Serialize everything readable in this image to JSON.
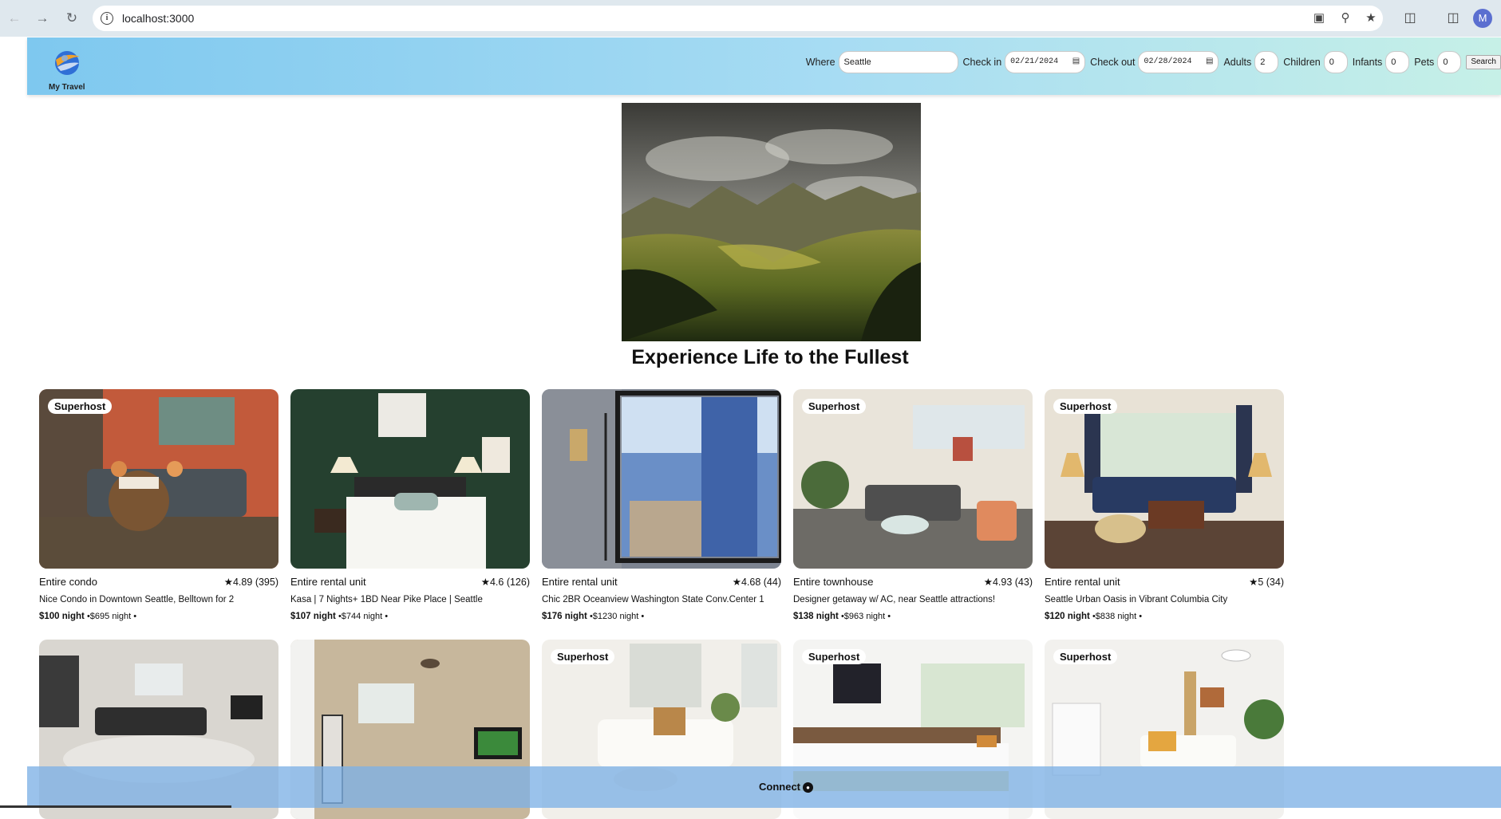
{
  "browser": {
    "url": "localhost:3000",
    "profile_initial": "M",
    "icons": [
      "back-icon",
      "forward-icon",
      "reload-icon",
      "site-info-icon",
      "install-app-icon",
      "zoom-icon",
      "bookmark-star-icon",
      "extensions-icon",
      "side-panel-icon"
    ]
  },
  "header": {
    "logo_text": "My Travel",
    "where_label": "Where",
    "where_value": "Seattle",
    "checkin_label": "Check in",
    "checkin_value": "02/21/2024",
    "checkout_label": "Check out",
    "checkout_value": "02/28/2024",
    "adults_label": "Adults",
    "adults_value": "2",
    "children_label": "Children",
    "children_value": "0",
    "infants_label": "Infants",
    "infants_value": "0",
    "pets_label": "Pets",
    "pets_value": "0",
    "search_label": "Search"
  },
  "hero": {
    "title": "Experience Life to the Fullest"
  },
  "listings": [
    {
      "superhost": "Superhost",
      "type": "Entire condo",
      "rating": "4.89",
      "reviews": "(395)",
      "title": "Nice Condo in Downtown Seattle, Belltown for 2",
      "price": "$100 night",
      "total": "•$695 night •"
    },
    {
      "superhost": "",
      "type": "Entire rental unit",
      "rating": "4.6",
      "reviews": "(126)",
      "title": "Kasa | 7 Nights+ 1BD Near Pike Place | Seattle",
      "price": "$107 night",
      "total": "•$744 night •"
    },
    {
      "superhost": "",
      "type": "Entire rental unit",
      "rating": "4.68",
      "reviews": "(44)",
      "title": "Chic 2BR Oceanview Washington State Conv.Center 1",
      "price": "$176 night",
      "total": "•$1230 night •"
    },
    {
      "superhost": "Superhost",
      "type": "Entire townhouse",
      "rating": "4.93",
      "reviews": "(43)",
      "title": "Designer getaway w/ AC, near Seattle attractions!",
      "price": "$138 night",
      "total": "•$963 night •"
    },
    {
      "superhost": "Superhost",
      "type": "Entire rental unit",
      "rating": "5",
      "reviews": "(34)",
      "title": "Seattle Urban Oasis in Vibrant Columbia City",
      "price": "$120 night",
      "total": "•$838 night •"
    },
    {
      "superhost": ""
    },
    {
      "superhost": ""
    },
    {
      "superhost": "Superhost"
    },
    {
      "superhost": "Superhost"
    },
    {
      "superhost": "Superhost"
    }
  ],
  "footer": {
    "connect_label": "Connect"
  },
  "colors": {
    "header_gradient_start": "#7ec8ef",
    "header_gradient_end": "#c6f0e7",
    "footer_bg": "#7eb1e6"
  }
}
